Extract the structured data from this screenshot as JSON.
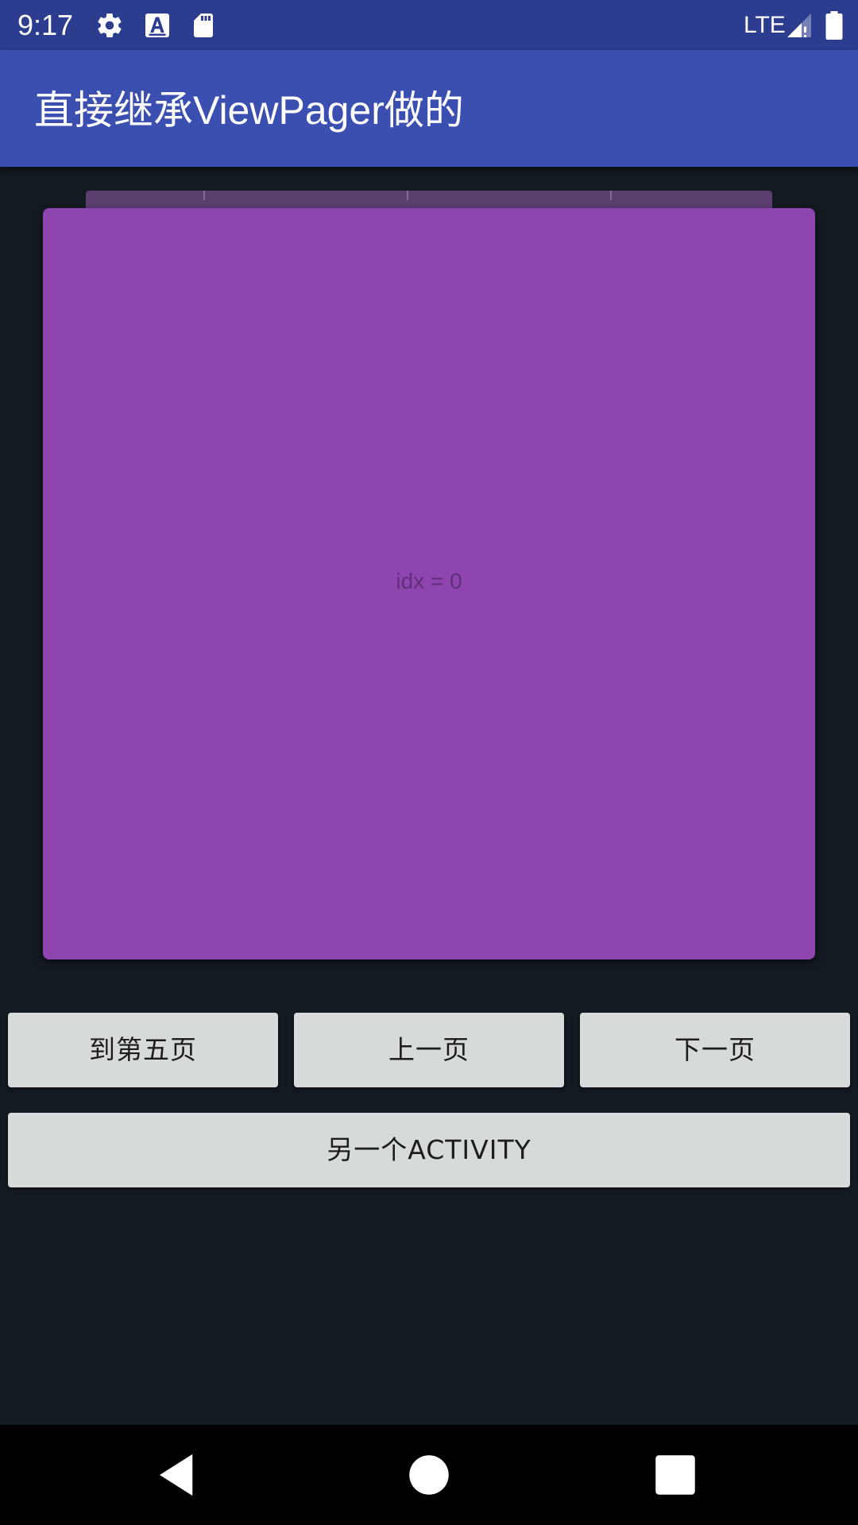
{
  "status_bar": {
    "time": "9:17",
    "network": "LTE",
    "icons": [
      "gear-icon",
      "font-a-icon",
      "sd-card-icon",
      "signal-icon",
      "battery-icon"
    ]
  },
  "app_bar": {
    "title": "直接继承ViewPager做的"
  },
  "pager": {
    "label": "idx = 0",
    "card_color": "#8f45b0"
  },
  "buttons": {
    "goto_page_five": "到第五页",
    "previous_page": "上一页",
    "next_page": "下一页",
    "another_activity": "另一个ACTIVITY"
  },
  "nav_bar": {
    "icons": [
      "back-icon",
      "home-icon",
      "recents-icon"
    ]
  },
  "colors": {
    "status_bar": "#2c3d8f",
    "app_bar": "#3a4fb0",
    "background": "#141a22",
    "button": "#d6dadb"
  }
}
